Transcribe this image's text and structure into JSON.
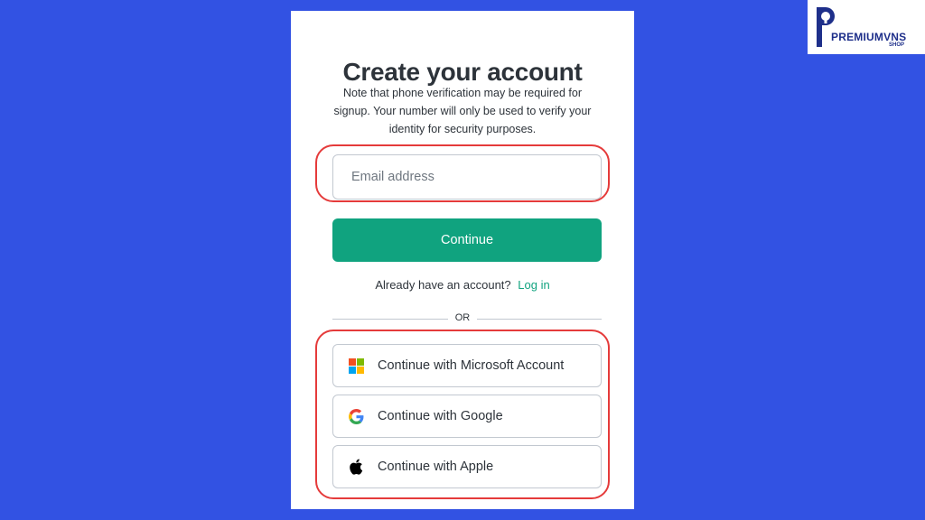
{
  "signup": {
    "title": "Create your account",
    "note": "Note that phone verification may be required for signup. Your number will only be used to verify your identity for security purposes.",
    "email_placeholder": "Email address",
    "continue_label": "Continue",
    "login_prompt": "Already have an account?",
    "login_link": "Log in",
    "divider": "OR",
    "social": [
      {
        "label": "Continue with Microsoft Account",
        "icon": "microsoft-icon"
      },
      {
        "label": "Continue with Google",
        "icon": "google-icon"
      },
      {
        "label": "Continue with Apple",
        "icon": "apple-icon"
      }
    ]
  },
  "watermark": {
    "brand": "PREMIUMVNS",
    "sub": "SHOP"
  },
  "colors": {
    "background": "#3252e3",
    "accent": "#10a37f",
    "highlight": "#e53b3b",
    "text": "#2d333a"
  }
}
